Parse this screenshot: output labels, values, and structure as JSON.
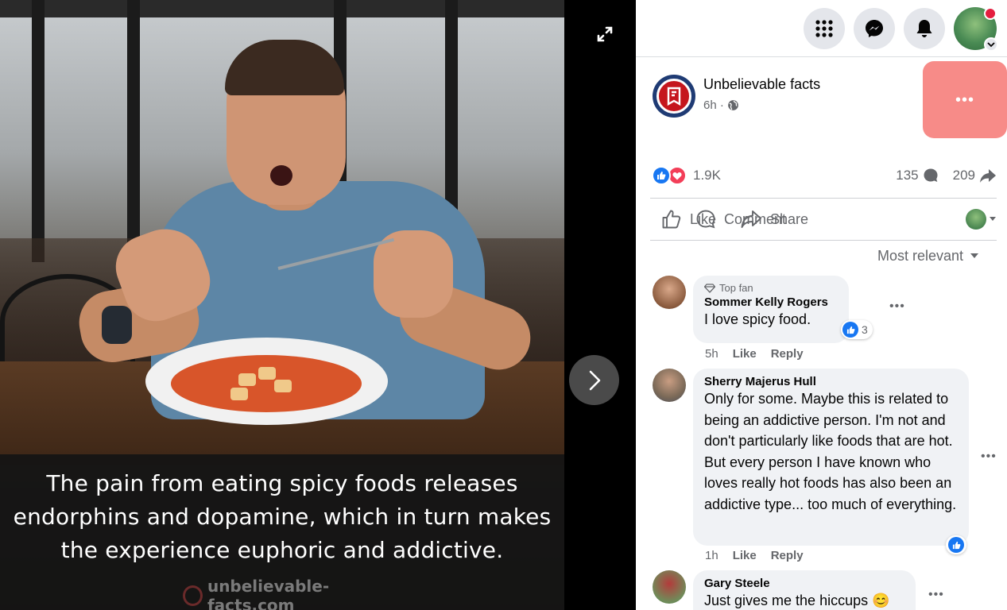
{
  "photo": {
    "caption": "The pain from eating spicy foods releases endorphins and dopamine, which in turn makes the experience euphoric and addictive.",
    "watermark": "unbelievable-facts.com"
  },
  "viewer": {
    "fullscreen_icon": "expand-icon",
    "next_icon": "chevron-right-icon"
  },
  "topbar": {
    "menu_icon": "grid-menu-icon",
    "messenger_icon": "messenger-icon",
    "notifications_icon": "bell-icon",
    "account_icon": "account-avatar"
  },
  "post": {
    "page_name": "Unbelievable facts",
    "time": "6h ·",
    "privacy_icon": "globe-icon",
    "more_label": "•••",
    "reactions_count": "1.9K",
    "comments_count": "135",
    "shares_count": "209"
  },
  "actions": {
    "like": "Like",
    "comment": "Comment",
    "share": "Share"
  },
  "sort": {
    "label": "Most relevant"
  },
  "comments": [
    {
      "badge": "Top fan",
      "author": "Sommer Kelly Rogers",
      "text": "I love spicy food.",
      "reactions": "3",
      "time": "5h",
      "like": "Like",
      "reply": "Reply"
    },
    {
      "author": "Sherry Majerus Hull",
      "text": "Only for some. Maybe this is related to being an addictive person. I'm not and don't particularly like foods that are hot. But every person I have known who loves really hot foods has also been an addictive type... too much of everything.",
      "time": "1h",
      "like": "Like",
      "reply": "Reply"
    },
    {
      "author": "Gary Steele",
      "text": "Just gives me the hiccups 😊"
    }
  ],
  "colors": {
    "accent": "#1877f2",
    "love": "#f33e58",
    "highlight": "#f78b88",
    "bubble": "#f0f2f5",
    "secondary_text": "#65676b"
  }
}
